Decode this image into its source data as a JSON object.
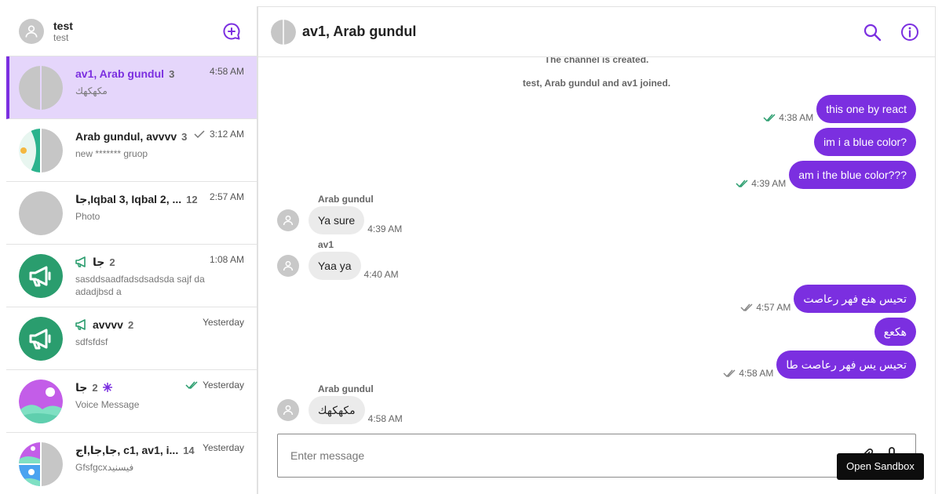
{
  "user": {
    "name": "test",
    "subtitle": "test"
  },
  "chats": [
    {
      "title": "av1, Arab gundul",
      "count": "3",
      "time": "4:58 AM",
      "preview": "مكهكهك",
      "active": true
    },
    {
      "title": "Arab gundul, avvvv",
      "count": "3",
      "time": "3:12 AM",
      "preview": "new ******* gruop",
      "check": "single"
    },
    {
      "title": "جا,Iqbal 3, Iqbal 2, ...",
      "count": "12",
      "time": "2:57 AM",
      "preview": "Photo"
    },
    {
      "title": "جا",
      "count": "2",
      "time": "1:08 AM",
      "preview": "sasddsaadfadsdsadsda sajf da adadjbsd a",
      "icon": "megaphone-icon"
    },
    {
      "title": "avvvv",
      "count": "2",
      "time": "Yesterday",
      "preview": "sdfsfdsf",
      "icon": "megaphone-icon"
    },
    {
      "title": "جا",
      "count": "2",
      "time": "Yesterday",
      "preview": "Voice Message",
      "check": "double"
    },
    {
      "title": "جا,جا,اج, c1, av1, i...",
      "count": "14",
      "time": "Yesterday",
      "preview": "Gfsfgcxفيسنيد"
    }
  ],
  "conversation": {
    "title": "av1, Arab gundul",
    "system_messages": [
      "The channel is created.",
      "test, Arab gundul and av1 joined."
    ],
    "messages": [
      {
        "dir": "out",
        "text": "this one by react",
        "time": "4:38 AM",
        "status": "read"
      },
      {
        "dir": "out",
        "text": "im i a blue color?"
      },
      {
        "dir": "out",
        "text": "am i the blue color???",
        "time": "4:39 AM",
        "status": "read"
      },
      {
        "dir": "in",
        "sender": "Arab gundul",
        "text": "Ya sure",
        "time": "4:39 AM"
      },
      {
        "dir": "in",
        "sender": "av1",
        "text": "Yaa ya",
        "time": "4:40 AM"
      },
      {
        "dir": "out",
        "text": "تحيس هنع فهر رعاصت",
        "time": "4:57 AM",
        "status": "delivered"
      },
      {
        "dir": "out",
        "text": "هكعع"
      },
      {
        "dir": "out",
        "text": "تحيس يس فهر رعاصت طا",
        "time": "4:58 AM",
        "status": "delivered"
      },
      {
        "dir": "in",
        "sender": "Arab gundul",
        "text": "مكهكهك",
        "time": "4:58 AM"
      }
    ]
  },
  "composer": {
    "placeholder": "Enter message"
  },
  "sandbox": {
    "label": "Open Sandbox"
  },
  "colors": {
    "accent": "#7b2fe0",
    "active_bg": "#e5d6fb",
    "read_check": "#2a9d6e",
    "channel_green": "#2a9d6e"
  }
}
